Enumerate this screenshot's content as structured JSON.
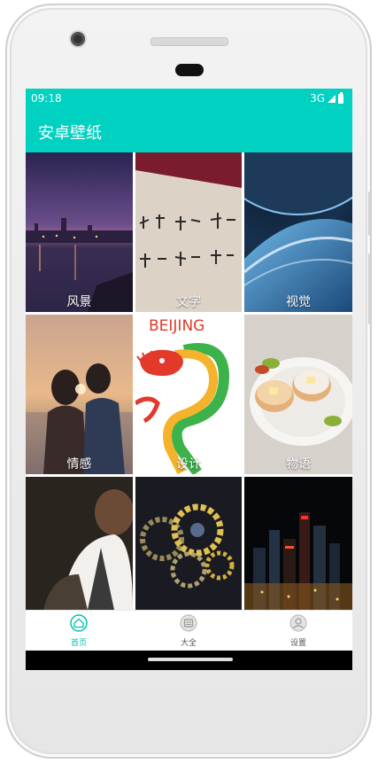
{
  "status_bar": {
    "time": "09:18",
    "network": "3G"
  },
  "app_bar": {
    "title": "安卓壁纸"
  },
  "tiles": [
    {
      "label": "风景",
      "image": "night-harbor-photo"
    },
    {
      "label": "文字",
      "image": "calligraphy-photo"
    },
    {
      "label": "视觉",
      "image": "planet-space-photo"
    },
    {
      "label": "情感",
      "image": "couple-sunset-photo"
    },
    {
      "label": "设计",
      "image": "beijing-dragon-illustration",
      "image_text": "BEIJING"
    },
    {
      "label": "物语",
      "image": "pancakes-plate-photo"
    },
    {
      "label": "",
      "image": "man-portrait-photo"
    },
    {
      "label": "",
      "image": "gears-heart-photo"
    },
    {
      "label": "",
      "image": "city-night-skyline-photo"
    }
  ],
  "bottom_nav": [
    {
      "label": "首页",
      "icon": "home-icon",
      "active": true
    },
    {
      "label": "大全",
      "icon": "list-icon",
      "active": false
    },
    {
      "label": "设置",
      "icon": "profile-icon",
      "active": false
    }
  ],
  "colors": {
    "accent": "#00d1c0",
    "active_nav": "#00c2b2"
  }
}
